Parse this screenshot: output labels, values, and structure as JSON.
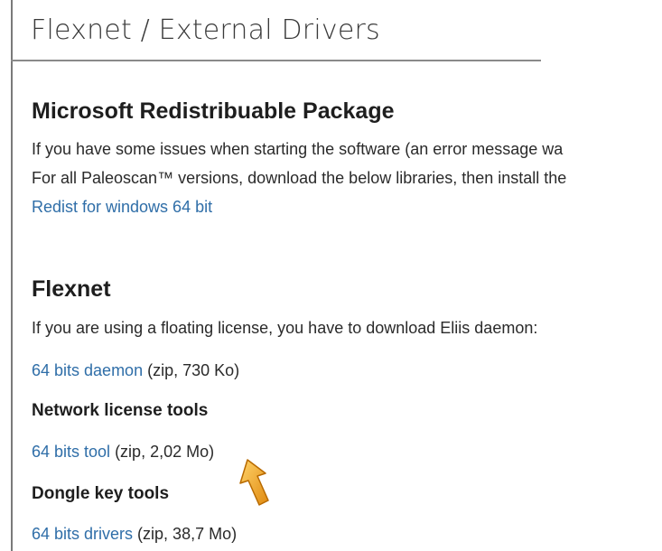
{
  "header": {
    "title": "Flexnet / External Drivers"
  },
  "redist": {
    "heading": "Microsoft Redistribuable Package",
    "line1": "If you have some issues when starting the software (an error message wa",
    "line2": "For all Paleoscan™ versions, download the below libraries, then install the",
    "link": "Redist for windows 64 bit"
  },
  "flexnet": {
    "heading": "Flexnet",
    "intro": "If you are using a floating license, you have to download Eliis daemon:",
    "daemon_link": "64 bits daemon",
    "daemon_meta": " (zip, 730 Ko)",
    "network_heading": "Network license tools",
    "tool_link": "64 bits tool",
    "tool_meta": " (zip, 2,02 Mo)",
    "dongle_heading": "Dongle key tools",
    "drivers_link": "64 bits drivers",
    "drivers_meta": " (zip, 38,7 Mo)"
  },
  "icons": {
    "pointer": "arrow-pointer-icon"
  },
  "colors": {
    "link": "#2f6ea8",
    "arrow": "#f0a020"
  }
}
